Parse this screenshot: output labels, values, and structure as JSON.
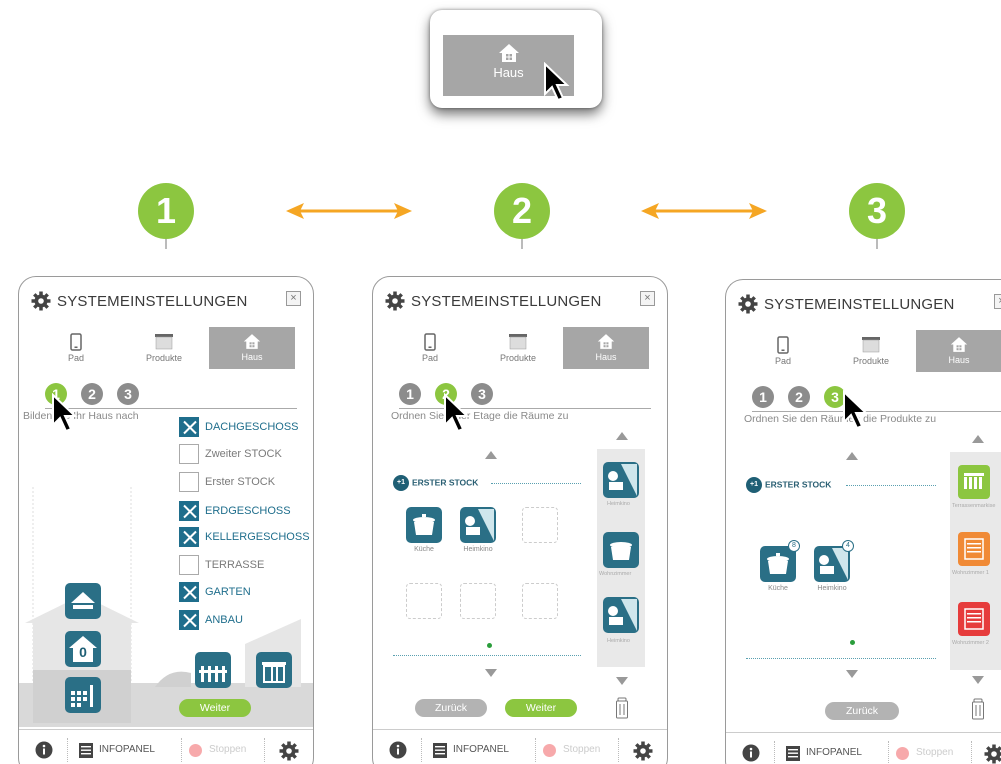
{
  "top_button": {
    "label": "Haus"
  },
  "steps": [
    "1",
    "2",
    "3"
  ],
  "panel": {
    "title": "SYSTEMEINSTELLUNGEN",
    "close": "×",
    "tabs": [
      "Pad",
      "Produkte",
      "Haus"
    ],
    "step_numbers": [
      "1",
      "2",
      "3"
    ],
    "footer": {
      "info_panel": "INFOPANEL",
      "stop": "Stoppen"
    }
  },
  "panel1": {
    "instruction": "Bilden Sie Ihr Haus nach",
    "floors": [
      {
        "label": "DACHGESCHOSS",
        "checked": true
      },
      {
        "label": "Zweiter STOCK",
        "checked": false
      },
      {
        "label": "Erster STOCK",
        "checked": false
      },
      {
        "label": "ERDGESCHOSS",
        "checked": true
      },
      {
        "label": "KELLERGESCHOSS",
        "checked": true
      },
      {
        "label": "TERRASSE",
        "checked": false
      },
      {
        "label": "GARTEN",
        "checked": true
      },
      {
        "label": "ANBAU",
        "checked": true
      }
    ],
    "house_floor_number": "0",
    "next": "Weiter"
  },
  "panel2": {
    "instruction": "Ordnen Sie jeder Etage die Räume zu",
    "floor": {
      "badge": "+1",
      "name": "ERSTER STOCK"
    },
    "rooms": [
      "Küche",
      "Heimkino"
    ],
    "side_rooms": [
      "Heimkino",
      "Wohnzimmer",
      "Heimkino"
    ],
    "back": "Zurück",
    "next": "Weiter"
  },
  "panel3": {
    "instruction": "Ordnen Sie den Räumen die Produkte zu",
    "floor": {
      "badge": "+1",
      "name": "ERSTER STOCK"
    },
    "rooms": [
      {
        "name": "Küche",
        "count": "8"
      },
      {
        "name": "Heimkino",
        "count": "4"
      }
    ],
    "side_products": [
      "Terrassenmarkise",
      "Wohnzimmer 1",
      "Wohnzimmer 2"
    ],
    "back": "Zurück"
  },
  "colors": {
    "accent_green": "#8cc640",
    "teal": "#1f6e8c",
    "orange": "#f5a623",
    "tab_active": "#a6a6a6"
  },
  "icons": [
    "gear-icon",
    "close-icon",
    "tablet-icon",
    "blind-icon",
    "house-icon",
    "info-icon",
    "list-icon",
    "stop-icon",
    "cursor-icon",
    "chevron-up-icon",
    "chevron-down-icon",
    "trash-icon"
  ]
}
